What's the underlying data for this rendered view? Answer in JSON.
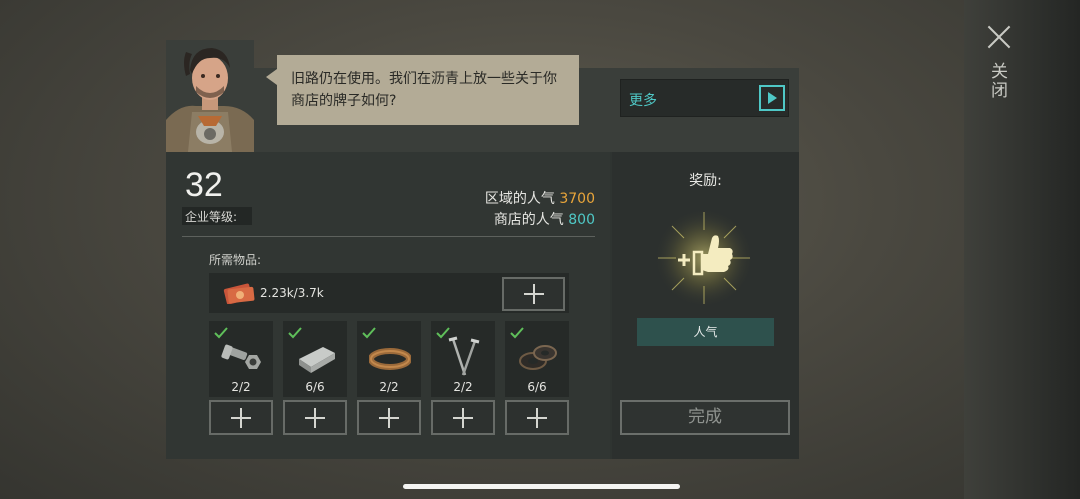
{
  "close": {
    "label": "关闭"
  },
  "dialog": {
    "speech": "旧路仍在使用。我们在沥青上放一些关于你商店的牌子如何?",
    "more_label": "更多"
  },
  "company": {
    "level": "32",
    "level_label": "企业等级:",
    "region_pop_label": "区域的人气",
    "region_pop_value": "3700",
    "shop_pop_label": "商店的人气",
    "shop_pop_value": "800"
  },
  "requirements": {
    "label": "所需物品:",
    "money": "2.23k/3.7k",
    "items": [
      {
        "icon": "bolt-nut-icon",
        "count": "2/2",
        "complete": true
      },
      {
        "icon": "metal-ingot-icon",
        "count": "6/6",
        "complete": true
      },
      {
        "icon": "leather-strap-icon",
        "count": "2/2",
        "complete": true
      },
      {
        "icon": "nails-icon",
        "count": "2/2",
        "complete": true
      },
      {
        "icon": "rubber-ring-icon",
        "count": "6/6",
        "complete": true
      }
    ]
  },
  "reward": {
    "label": "奖励:",
    "icon": "thumbs-up-plus-icon",
    "type": "人气"
  },
  "complete_button": "完成",
  "colors": {
    "accent_teal": "#4fc8c6",
    "accent_orange": "#e9a53a",
    "check_green": "#5fbf5a",
    "reward_glow": "#e8d86a"
  }
}
